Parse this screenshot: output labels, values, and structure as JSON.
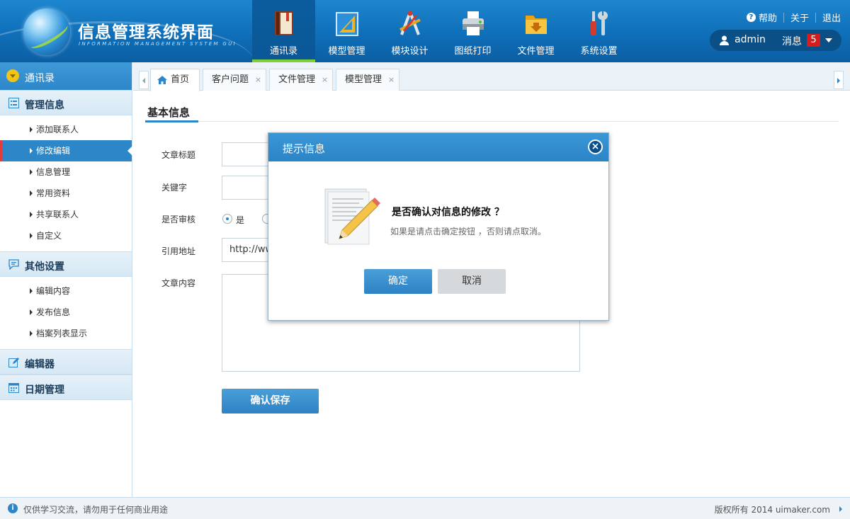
{
  "app": {
    "title": "信息管理系统界面",
    "subtitle": "INFORMATION MANAGEMENT SYSTEM GUI"
  },
  "topnav": {
    "items": [
      {
        "label": "通讯录",
        "icon": "book-icon",
        "active": true
      },
      {
        "label": "模型管理",
        "icon": "ruler-triangle-icon"
      },
      {
        "label": "模块设计",
        "icon": "design-tools-icon"
      },
      {
        "label": "图纸打印",
        "icon": "printer-icon"
      },
      {
        "label": "文件管理",
        "icon": "folder-icon"
      },
      {
        "label": "系统设置",
        "icon": "tools-icon"
      }
    ]
  },
  "toplinks": {
    "help": "帮助",
    "about": "关于",
    "logout": "退出"
  },
  "user": {
    "name": "admin",
    "messages_label": "消息",
    "messages_count": "5"
  },
  "sidebar": {
    "header": "通讯录",
    "groups": [
      {
        "title": "管理信息",
        "icon": "list-icon",
        "items": [
          "添加联系人",
          "修改编辑",
          "信息管理",
          "常用资料",
          "共享联系人",
          "自定义"
        ]
      },
      {
        "title": "其他设置",
        "icon": "chat-icon",
        "items": [
          "编辑内容",
          "发布信息",
          "档案列表显示"
        ]
      },
      {
        "title": "编辑器",
        "icon": "edit-icon",
        "items": []
      },
      {
        "title": "日期管理",
        "icon": "calendar-icon",
        "items": []
      }
    ],
    "active_item": "修改编辑"
  },
  "tabs": [
    {
      "label": "首页",
      "home": true
    },
    {
      "label": "客户问题",
      "closable": true
    },
    {
      "label": "文件管理",
      "closable": true
    },
    {
      "label": "模型管理",
      "closable": true
    }
  ],
  "tab_close_symbol": "×",
  "form": {
    "section_title": "基本信息",
    "labels": {
      "title": "文章标题",
      "keywords": "关键字",
      "review": "是否审核",
      "ref_url": "引用地址",
      "content": "文章内容"
    },
    "review_yes": "是",
    "ref_url_value": "http://ww",
    "save_button": "确认保存"
  },
  "dialog": {
    "title": "提示信息",
    "close_symbol": "×",
    "question": "是否确认对信息的修改 ？",
    "hint": "如果是请点击确定按钮 ，否则请点取消。",
    "ok": "确定",
    "cancel": "取消"
  },
  "footer": {
    "note": "仅供学习交流，请勿用于任何商业用途",
    "copyright": "版权所有 2014 uimaker.com"
  },
  "colors": {
    "header_blue": "#0f6fb8",
    "accent_blue": "#2d86c8",
    "active_green": "#7fd13b",
    "badge_red": "#d61c1c"
  }
}
